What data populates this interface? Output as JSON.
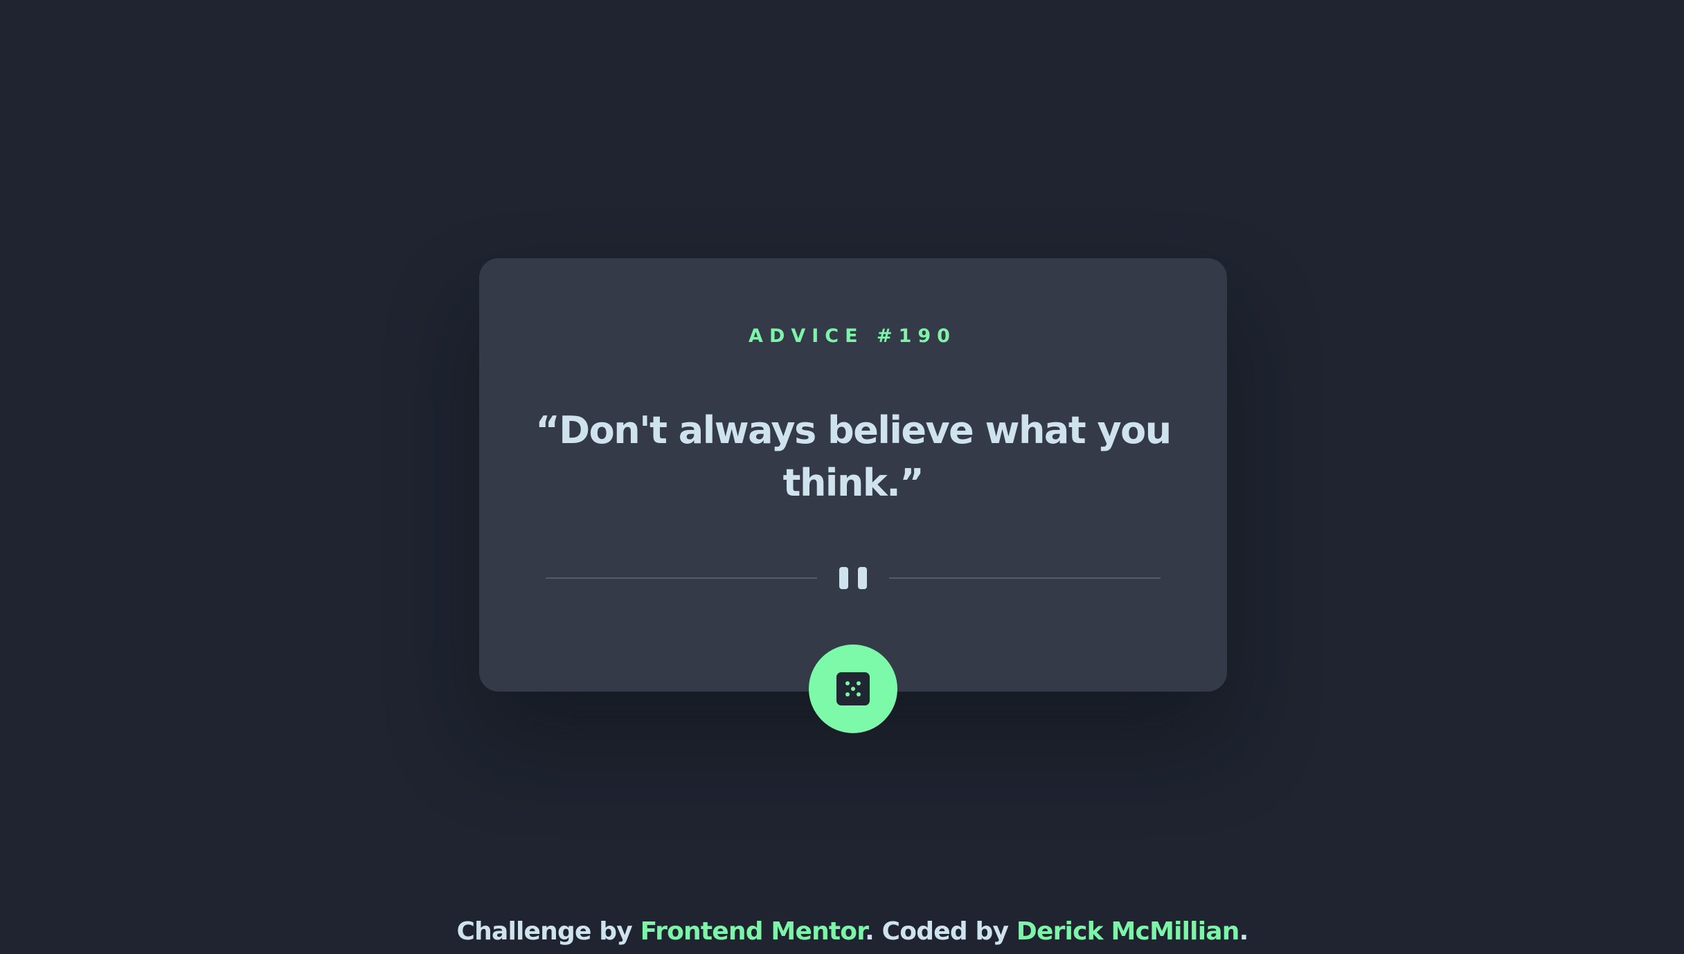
{
  "advice": {
    "label": "ADVICE #190",
    "quote": "“Don't always believe what you think.”"
  },
  "divider": {
    "icon": "pause-icon"
  },
  "dice_button": {
    "icon": "dice-icon"
  },
  "footer": {
    "prefix": "Challenge by ",
    "link1": "Frontend Mentor",
    "middle": ". Coded by ",
    "link2": "Derick McMillian",
    "suffix": "."
  },
  "colors": {
    "background": "#1f2430",
    "card": "#353a49",
    "accent": "#7df5a8",
    "text": "#cfe3ee"
  }
}
